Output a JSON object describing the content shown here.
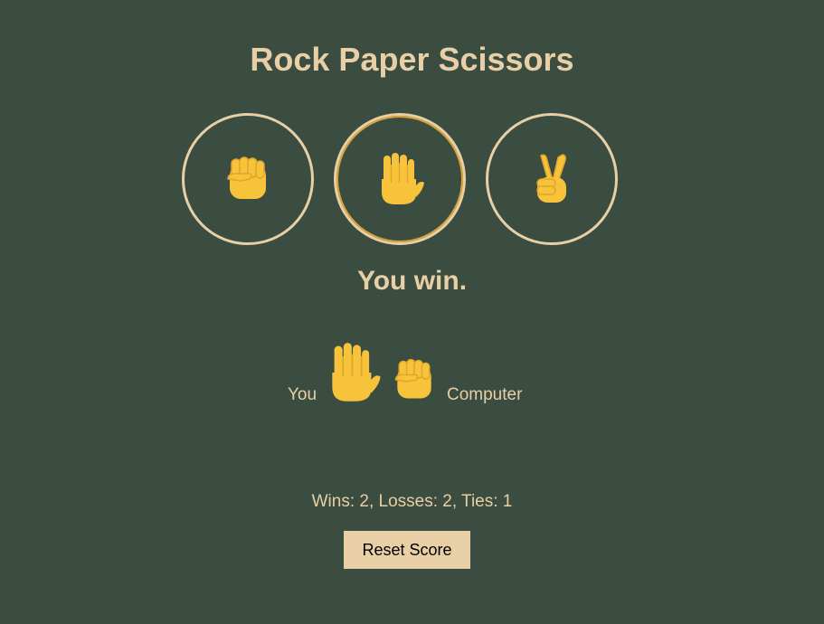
{
  "title": "Rock Paper Scissors",
  "choices": [
    {
      "name": "rock",
      "icon": "fist-icon",
      "selected": false
    },
    {
      "name": "paper",
      "icon": "raised-hand-icon",
      "selected": true
    },
    {
      "name": "scissors",
      "icon": "victory-hand-icon",
      "selected": false
    }
  ],
  "result": "You win.",
  "moves": {
    "you_label": "You",
    "you_move_icon": "raised-hand-icon",
    "computer_move_icon": "fist-icon",
    "computer_label": "Computer"
  },
  "score": {
    "text": "Wins: 2, Losses: 2, Ties: 1"
  },
  "reset_label": "Reset Score",
  "colors": {
    "background": "#3b4d41",
    "text": "#e8cfa6",
    "button_bg": "#e8cfa6",
    "emoji": "#f7c33a"
  }
}
